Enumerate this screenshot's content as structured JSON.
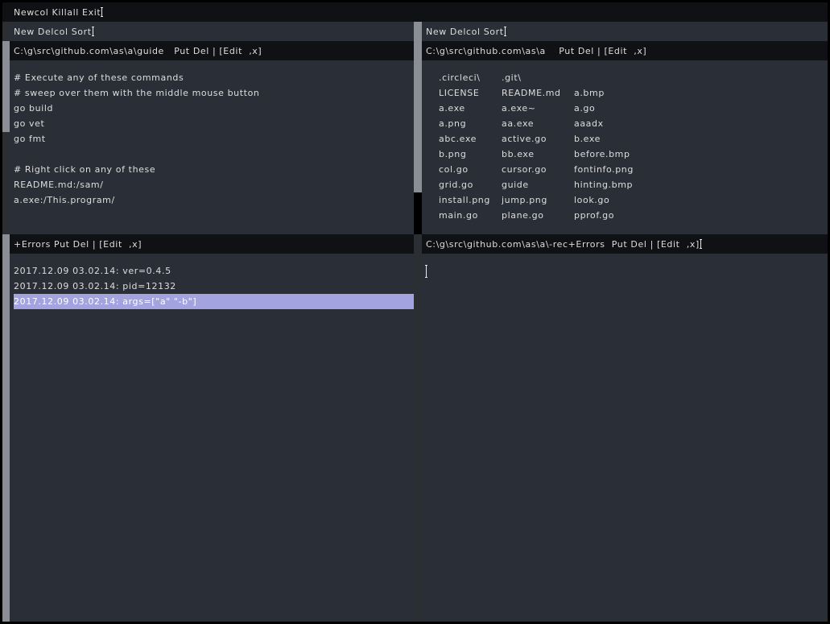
{
  "top_tag": "Newcol Killall Exit",
  "left_column": {
    "col_tag": "New Delcol Sort",
    "window1": {
      "tag": "C:\\g\\src\\github.com\\as\\a\\guide   Put Del | [Edit  ,x]",
      "lines": [
        "# Execute any of these commands",
        "# sweep over them with the middle mouse button",
        "go build",
        "go vet",
        "go fmt",
        "",
        "# Right click on any of these",
        "README.md:/sam/",
        "a.exe:/This.program/"
      ]
    },
    "window2": {
      "tag": "+Errors Put Del | [Edit  ,x]",
      "lines": [
        "2017.12.09 03.02.14: ver=0.4.5",
        "2017.12.09 03.02.14: pid=12132"
      ],
      "selected_line": "2017.12.09 03.02.14: args=[\"a\" \"-b\"]"
    }
  },
  "right_column": {
    "col_tag": "New Delcol Sort",
    "window1": {
      "tag": "C:\\g\\src\\github.com\\as\\a    Put Del | [Edit  ,x]",
      "files": [
        [
          ".circleci\\",
          ".git\\",
          ""
        ],
        [
          "LICENSE",
          "README.md",
          "a.bmp"
        ],
        [
          "a.exe",
          "a.exe~",
          "a.go"
        ],
        [
          "a.png",
          "aa.exe",
          "aaadx"
        ],
        [
          "abc.exe",
          "active.go",
          "b.exe"
        ],
        [
          "b.png",
          "bb.exe",
          "before.bmp"
        ],
        [
          "col.go",
          "cursor.go",
          "fontinfo.png"
        ],
        [
          "grid.go",
          "guide",
          "hinting.bmp"
        ],
        [
          "install.png",
          "jump.png",
          "look.go"
        ],
        [
          "main.go",
          "plane.go",
          "pprof.go"
        ]
      ]
    },
    "window2": {
      "tag": "C:\\g\\src\\github.com\\as\\a\\-rec+Errors  Put Del | [Edit  ,x]"
    }
  },
  "colors": {
    "body": "#2a2f37",
    "tag": "#0f1114",
    "selection": "#a3a3e0"
  }
}
